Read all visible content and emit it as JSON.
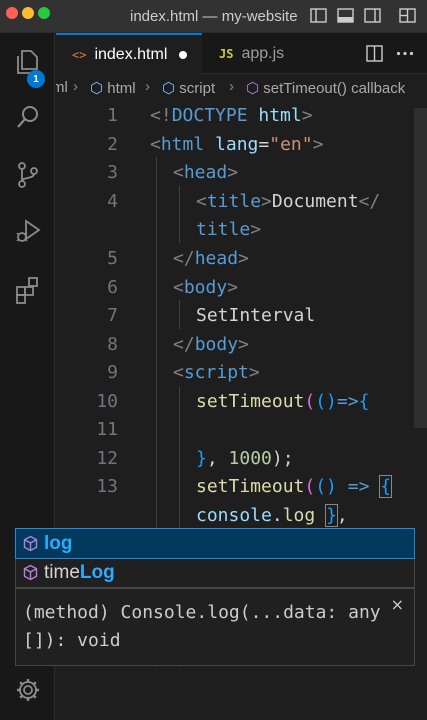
{
  "window": {
    "title": "index.html — my-website"
  },
  "activity_bar": {
    "explorer_badge": "1",
    "items": [
      "files-icon",
      "search-icon",
      "source-control-icon",
      "run-debug-icon",
      "extensions-icon",
      "gear-icon"
    ]
  },
  "tabs": [
    {
      "icon": "<>",
      "label": "index.html",
      "dirty": true
    },
    {
      "icon": "JS",
      "label": "app.js"
    }
  ],
  "breadcrumb": {
    "items": [
      "ml",
      "html",
      "script",
      "setTimeout() callback"
    ]
  },
  "editor": {
    "line_numbers": [
      "1",
      "2",
      "3",
      "4",
      "",
      "5",
      "6",
      "7",
      "8",
      "9",
      "10",
      "11",
      "12",
      "13"
    ],
    "lines": {
      "l1": [
        "<!",
        "DOCTYPE",
        " html",
        ">"
      ],
      "l2": [
        "<",
        "html",
        " lang",
        "=",
        "\"en\"",
        ">"
      ],
      "l3": [
        "<",
        "head",
        ">"
      ],
      "l4": [
        "<",
        "title",
        ">",
        "Document",
        "</"
      ],
      "l4b": [
        "title",
        ">"
      ],
      "l5": [
        "</",
        "head",
        ">"
      ],
      "l6": [
        "<",
        "body",
        ">"
      ],
      "l7": [
        "SetInterval"
      ],
      "l8": [
        "</",
        "body",
        ">"
      ],
      "l9": [
        "<",
        "script",
        ">"
      ],
      "l10": [
        "setTimeout",
        "(",
        "()",
        "=>",
        "{"
      ],
      "l12": [
        "}",
        ", ",
        "1000",
        ");"
      ],
      "l13": [
        "setTimeout",
        "(",
        "()",
        " => ",
        "{"
      ],
      "l14": [
        "console",
        ".",
        "log",
        " ",
        "}",
        ","
      ]
    }
  },
  "suggestions": [
    {
      "label": "log",
      "highlight": "log",
      "prefix": "",
      "selected": true
    },
    {
      "label": "timeLog",
      "highlight": "Log",
      "prefix": "time",
      "selected": false
    }
  ],
  "details": {
    "text": "(method) Console.log(...data: any[]): void",
    "close": "×"
  }
}
